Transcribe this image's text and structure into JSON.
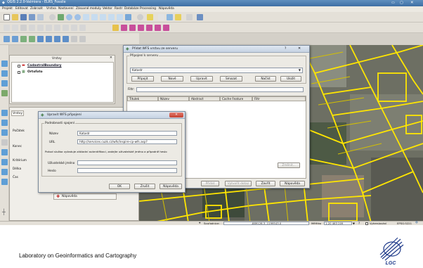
{
  "window": {
    "title": "QGIS 2.2.0-Valmiera - ELRS_Fossile"
  },
  "menu": [
    "Projekt",
    "Editovat",
    "Zobrazit",
    "Vrstva",
    "Nastavení",
    "Zásuvné moduly",
    "Vektor",
    "Rastr",
    "Databáze",
    "Processing",
    "Nápověda"
  ],
  "layers_panel": {
    "title": "Vrstvy",
    "items": [
      {
        "label": "CadastralBoundary",
        "checked": true
      },
      {
        "label": "Ortofoto",
        "checked": true
      }
    ]
  },
  "left_tabs": [
    "Vrstvy",
    "Prohlížeč"
  ],
  "browse_panel": {
    "labels": [
      "Počátek",
      "Konec",
      "Kritérium",
      "Délka",
      "Čas"
    ],
    "bottom_item": "Nápověda"
  },
  "wfs_dialog": {
    "title": "Přidat WFS vrstvu ze serveru",
    "help_icon": "?",
    "connections_group": "Připojení k serveru",
    "selected_connection": "Katastr",
    "buttons": [
      "Připojit",
      "Nové",
      "Upravit",
      "Smazat"
    ],
    "load_button": "Načíst",
    "save_button": "Uložit",
    "filter_label": "Filtr:",
    "columns": [
      "Titulek",
      "Název",
      "Abstract",
      "Cache Feature",
      "Filtr"
    ],
    "change_button": "Změnit...",
    "bottom_buttons": [
      "Přidat",
      "Vytvořit dotaz",
      "Zavřít",
      "Nápověda"
    ]
  },
  "conn_dialog": {
    "title": "Upravit WFS připojení",
    "group_title": "Podrobnosti spojení",
    "name_label": "Název",
    "name_value": "Katastr",
    "url_label": "URL",
    "url_value": "http://services.cuzk.cz/wfs/inspire-cp-wfs.asp?",
    "auth_note": "Pokud služba vyžaduje základní autentifikaci, zadejte uživatelské jméno a případně heslo",
    "user_label": "Uživatelské jméno",
    "pass_label": "Heslo",
    "buttons": [
      "OK",
      "Zrušit",
      "Nápověda"
    ]
  },
  "statusbar": {
    "coord_label": "Souřadnice:",
    "coord_value": "-889126.3,-1199543.0",
    "scale_label": "Měřítko",
    "scale_value": "1:20 463 209",
    "render_label": "Vykreslování",
    "epsg": "EPSG:5221"
  },
  "footer": {
    "text": "Laboratory on Geoinformatics and Cartography",
    "logo_text": "LGC"
  }
}
